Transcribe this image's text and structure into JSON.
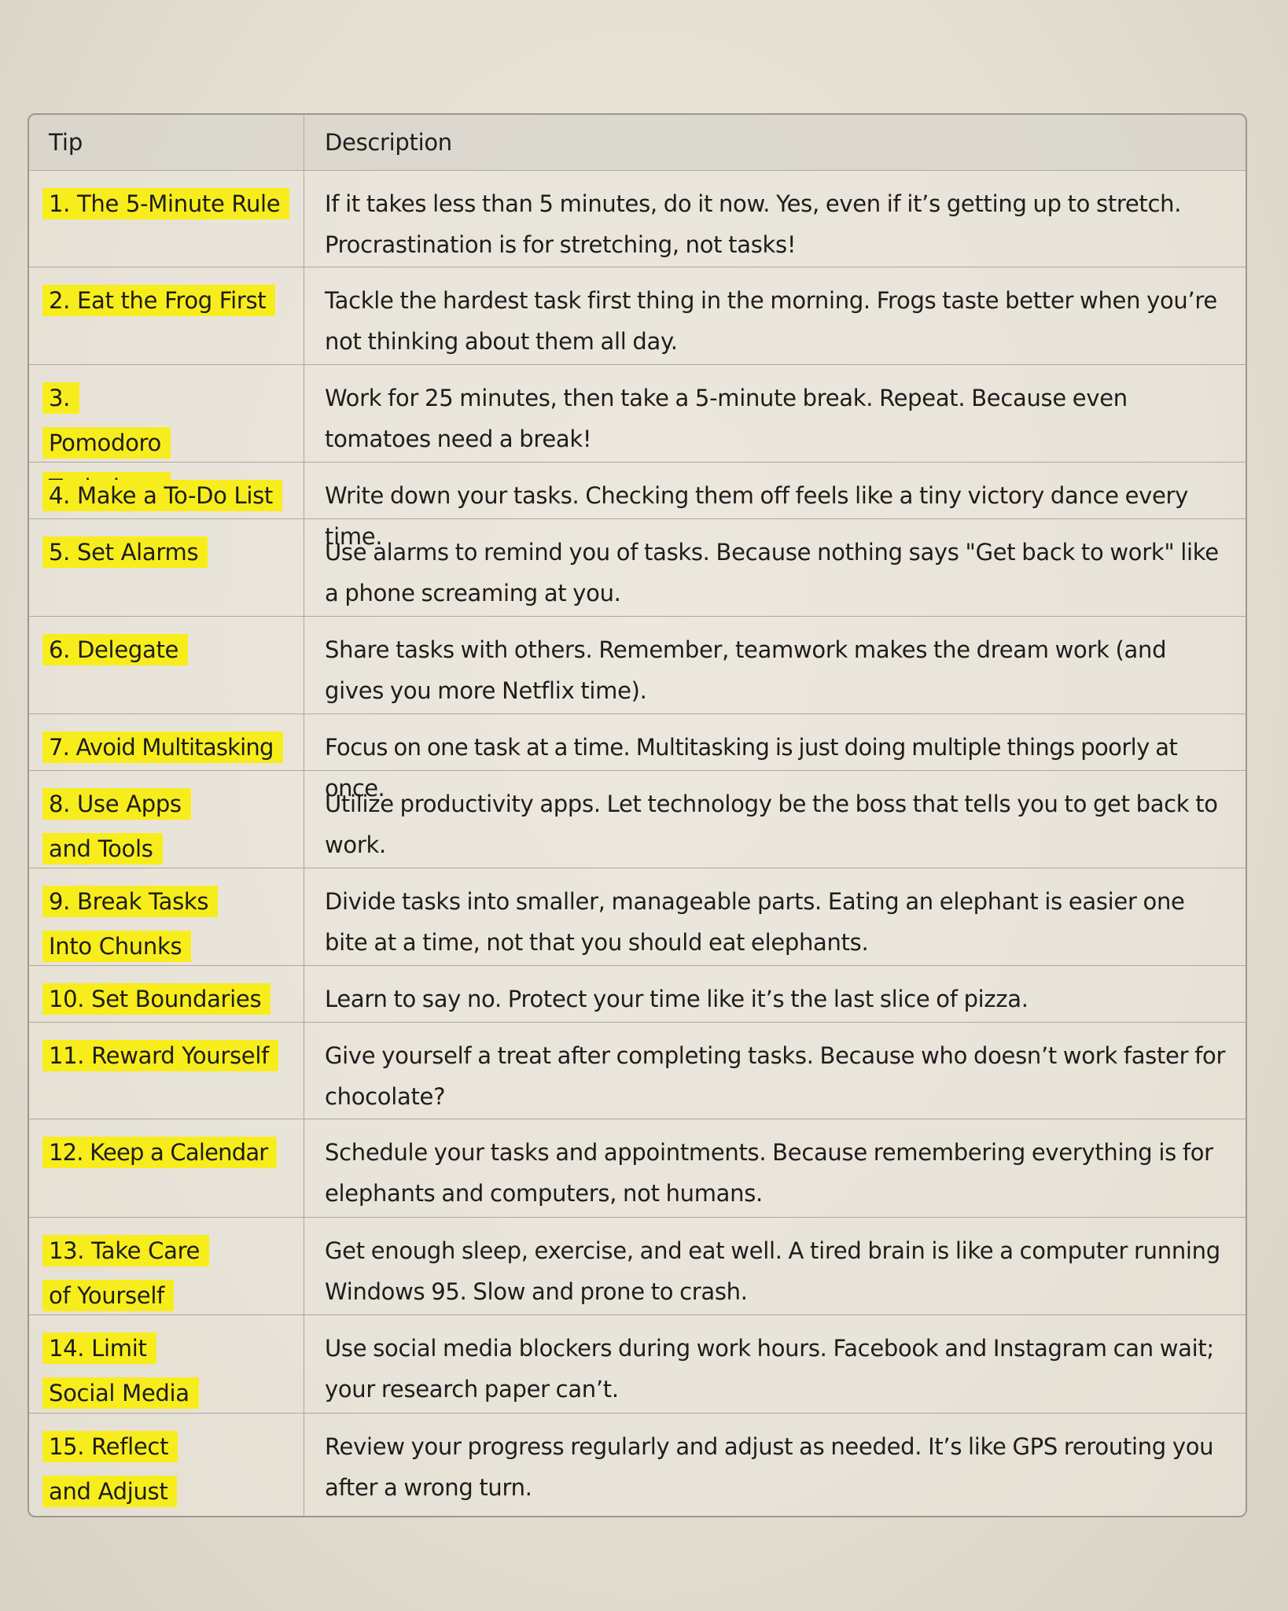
{
  "table": {
    "headers": {
      "tip": "Tip",
      "description": "Description"
    },
    "highlight_color": "#f8ed1c",
    "rows": [
      {
        "tip": "1. The 5-Minute Rule",
        "description": "If it takes less than 5 minutes, do it now. Yes, even if it’s getting up to stretch. Procrastination is for stretching, not tasks!"
      },
      {
        "tip": "2. Eat the Frog First",
        "description": "Tackle the hardest task first thing in the morning. Frogs taste better when you’re not thinking about them all day."
      },
      {
        "tip": "3. Pomodoro Technique",
        "description": "Work for 25 minutes, then take a 5-minute break. Repeat. Because even tomatoes need a break!"
      },
      {
        "tip": "4. Make a To-Do List",
        "description": "Write down your tasks. Checking them off feels like a tiny victory dance every time."
      },
      {
        "tip": "5. Set Alarms",
        "description": "Use alarms to remind you of tasks. Because nothing says \"Get back to work\" like a phone screaming at you."
      },
      {
        "tip": "6. Delegate",
        "description": "Share tasks with others. Remember, teamwork makes the dream work (and gives you more Netflix time)."
      },
      {
        "tip": "7. Avoid Multitasking",
        "description": "Focus on one task at a time. Multitasking is just doing multiple things poorly at once."
      },
      {
        "tip": "8. Use Apps and Tools",
        "description": "Utilize productivity apps. Let technology be the boss that tells you to get back to work."
      },
      {
        "tip": "9. Break Tasks Into Chunks",
        "description": "Divide tasks into smaller, manageable parts. Eating an elephant is easier one bite at a time, not that you should eat elephants."
      },
      {
        "tip": "10. Set Boundaries",
        "description": "Learn to say no. Protect your time like it’s the last slice of pizza."
      },
      {
        "tip": "11. Reward Yourself",
        "description": "Give yourself a treat after completing tasks. Because who doesn’t work faster for chocolate?"
      },
      {
        "tip": "12. Keep a Calendar",
        "description": "Schedule your tasks and appointments. Because remembering everything is for elephants and computers, not humans."
      },
      {
        "tip": "13. Take Care of Yourself",
        "description": "Get enough sleep, exercise, and eat well. A tired brain is like a computer running Windows 95. Slow and prone to crash."
      },
      {
        "tip": "14. Limit Social Media",
        "description": "Use social media blockers during work hours. Facebook and Instagram can wait; your research paper can’t."
      },
      {
        "tip": "15. Reflect and Adjust",
        "description": "Review your progress regularly and adjust as needed. It’s like GPS rerouting you after a wrong turn."
      }
    ]
  }
}
